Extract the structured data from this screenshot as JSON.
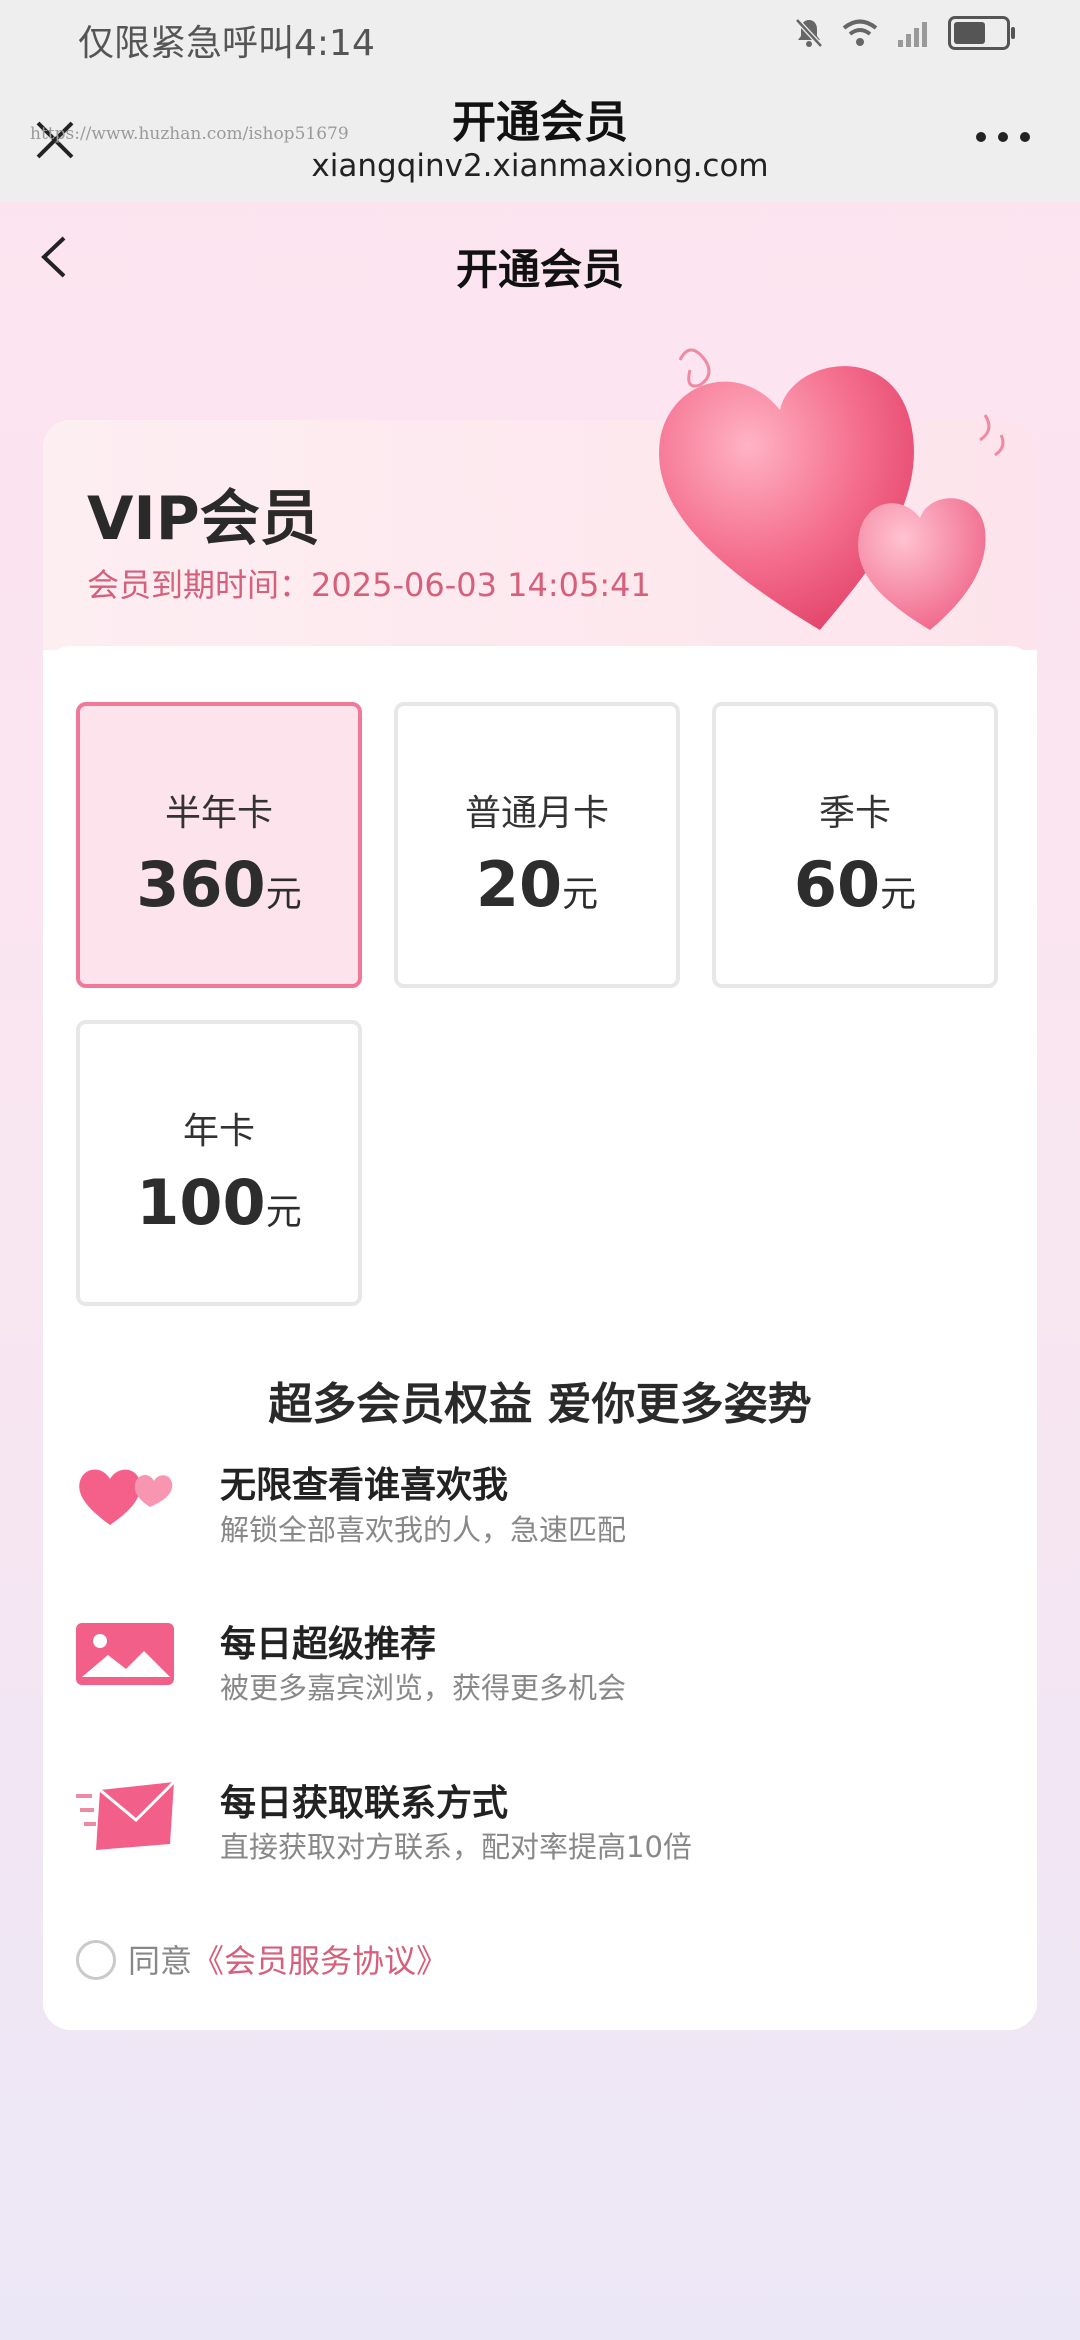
{
  "status_bar": {
    "carrier": "仅限紧急呼叫",
    "time": "4:14"
  },
  "browser": {
    "title": "开通会员",
    "url": "xiangqinv2.xianmaxiong.com",
    "watermark": "https://www.huzhan.com/ishop51679"
  },
  "header": {
    "title": "开通会员"
  },
  "membership": {
    "title": "VIP会员",
    "expire_label": "会员到期时间：",
    "expire_value": "2025-06-03 14:05:41"
  },
  "plans": [
    {
      "name": "半年卡",
      "price": "360",
      "unit": "元",
      "selected": true
    },
    {
      "name": "普通月卡",
      "price": "20",
      "unit": "元",
      "selected": false
    },
    {
      "name": "季卡",
      "price": "60",
      "unit": "元",
      "selected": false
    },
    {
      "name": "年卡",
      "price": "100",
      "unit": "元",
      "selected": false
    }
  ],
  "benefits": {
    "title": "超多会员权益 爱你更多姿势",
    "items": [
      {
        "icon": "hearts-icon",
        "title": "无限查看谁喜欢我",
        "desc": "解锁全部喜欢我的人，急速匹配"
      },
      {
        "icon": "image-icon",
        "title": "每日超级推荐",
        "desc": "被更多嘉宾浏览，获得更多机会"
      },
      {
        "icon": "envelope-icon",
        "title": "每日获取联系方式",
        "desc": "直接获取对方联系，配对率提高10倍"
      }
    ]
  },
  "agreement": {
    "prefix": "同意",
    "link": "《会员服务协议》"
  },
  "colors": {
    "accent": "#d65f7b",
    "selected_border": "#f07899",
    "selected_bg": "#fde4ec"
  }
}
